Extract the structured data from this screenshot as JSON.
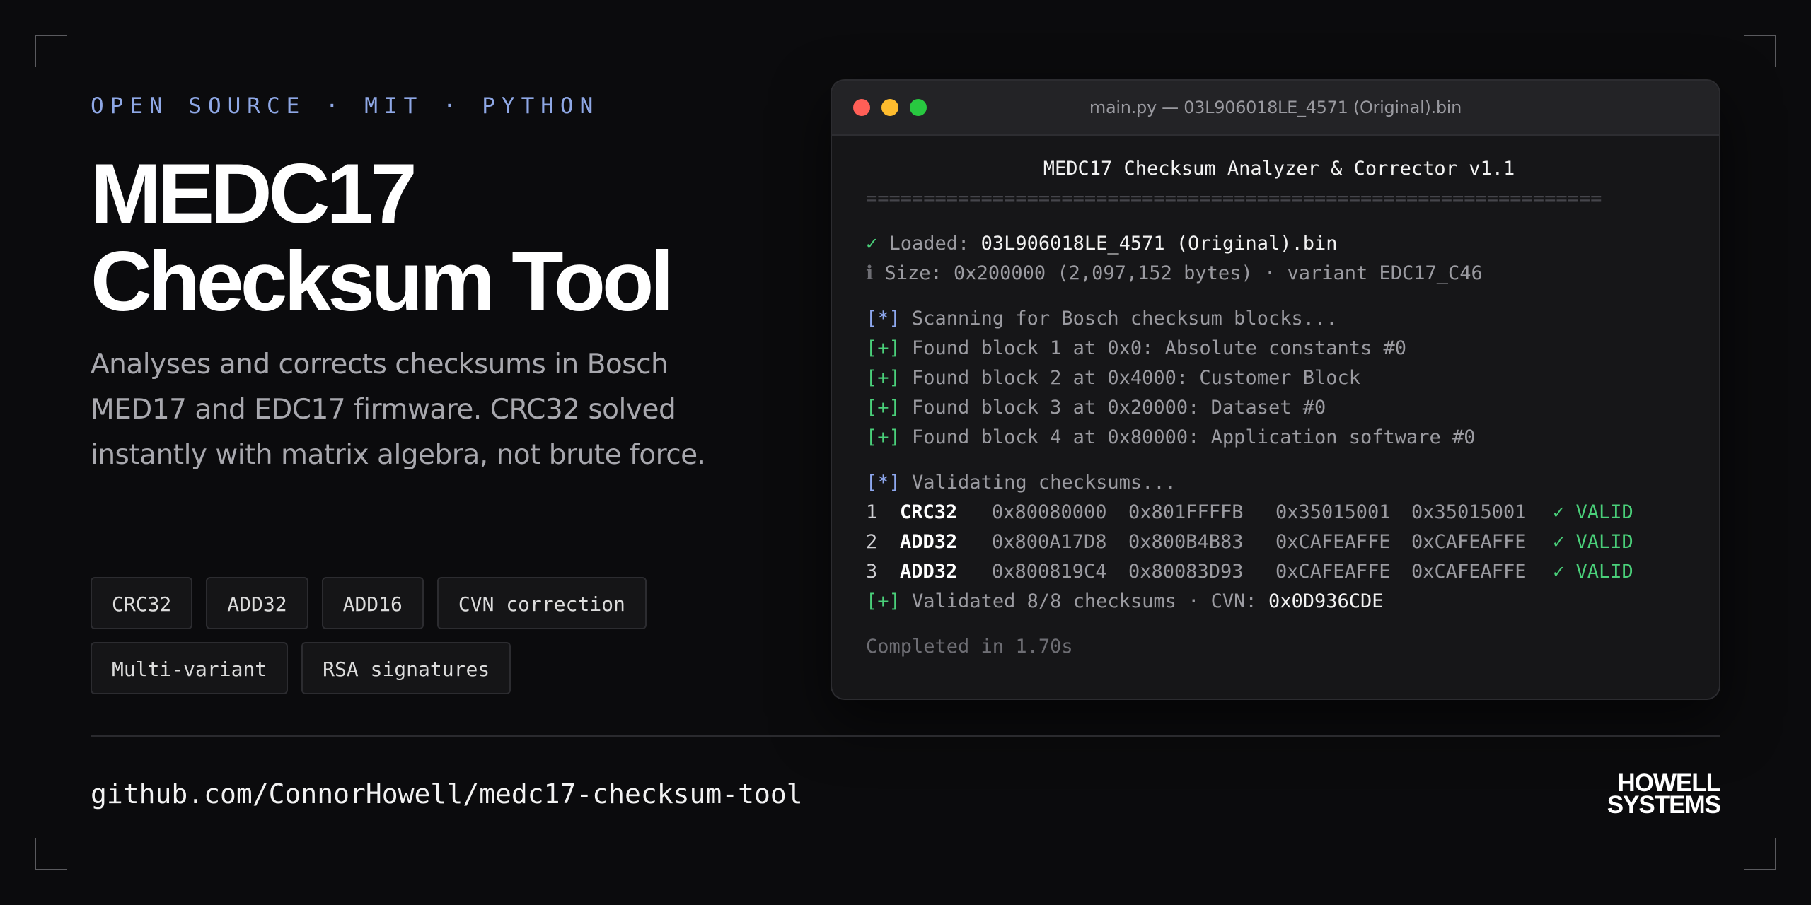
{
  "eyebrow": "OPEN SOURCE · MIT · PYTHON",
  "title_line1": "MEDC17",
  "title_line2": "Checksum Tool",
  "description": "Analyses and corrects checksums in Bosch MED17 and EDC17 firmware. CRC32 solved instantly with matrix algebra, not brute force.",
  "tags": [
    "CRC32",
    "ADD32",
    "ADD16",
    "CVN correction",
    "Multi-variant",
    "RSA signatures"
  ],
  "terminal": {
    "window_title": "main.py — 03L906018LE_4571 (Original).bin",
    "header": "MEDC17 Checksum Analyzer & Corrector v1.1",
    "rule": "================================================================",
    "check_glyph": "✓",
    "info_glyph": "ℹ",
    "loaded_label": " Loaded: ",
    "loaded_file": "03L906018LE_4571 (Original).bin",
    "size_line": " Size: 0x200000 (2,097,152 bytes) · variant EDC17_C46",
    "scan_prefix": "[*]",
    "scan_text": " Scanning for Bosch checksum blocks...",
    "found_prefix": "[+]",
    "found_lines": [
      " Found block 1 at 0x0: Absolute constants #0",
      " Found block 2 at 0x4000: Customer Block",
      " Found block 3 at 0x20000: Dataset #0",
      " Found block 4 at 0x80000: Application software #0"
    ],
    "validate_text": " Validating checksums...",
    "rows": [
      {
        "idx": "1",
        "algo": "CRC32",
        "start": "0x80080000",
        "end": "0x801FFFFB",
        "stored": "0x35015001",
        "computed": "0x35015001",
        "status": "✓ VALID"
      },
      {
        "idx": "2",
        "algo": "ADD32",
        "start": "0x800A17D8",
        "end": "0x800B4B83",
        "stored": "0xCAFEAFFE",
        "computed": "0xCAFEAFFE",
        "status": "✓ VALID"
      },
      {
        "idx": "3",
        "algo": "ADD32",
        "start": "0x800819C4",
        "end": "0x80083D93",
        "stored": "0xCAFEAFFE",
        "computed": "0xCAFEAFFE",
        "status": "✓ VALID"
      }
    ],
    "validated_text": " Validated 8/8 checksums · CVN: ",
    "cvn": "0x0D936CDE",
    "completed": "Completed in 1.70s"
  },
  "repo_url": "github.com/ConnorHowell/medc17-checksum-tool",
  "logo_line1": "HOWELL",
  "logo_line2": "SYSTEMS",
  "colors": {
    "background": "#0b0b0d",
    "accent_blue": "#8fa8e6",
    "valid_green": "#4ad07a",
    "close": "#ff5f57",
    "minimize": "#febc2e",
    "zoom": "#28c840"
  }
}
